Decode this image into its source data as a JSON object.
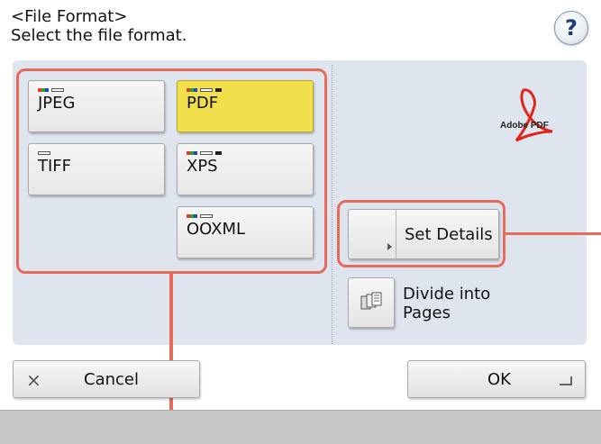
{
  "header": {
    "title": "<File Format>\nSelect the file format.",
    "help_label": "?"
  },
  "formats": [
    {
      "label": "JPEG",
      "icon": "color-mode-icon",
      "selected": false
    },
    {
      "label": "PDF",
      "icon": "color-mode-icon",
      "selected": true
    },
    {
      "label": "TIFF",
      "icon": "bw-mode-icon",
      "selected": false
    },
    {
      "label": "XPS",
      "icon": "color-mode-icon",
      "selected": false
    },
    {
      "label": "OOXML",
      "icon": "color-mode-icon",
      "selected": false
    }
  ],
  "side": {
    "logo_text": "Adobe PDF",
    "set_details_label": "Set Details",
    "divide_label": "Divide into\nPages"
  },
  "bottom": {
    "cancel_label": "Cancel",
    "cancel_icon": "×",
    "ok_label": "OK"
  },
  "colors": {
    "selected": "#f1df4b",
    "highlight": "#e86a58",
    "panel": "#dfe5ef"
  }
}
